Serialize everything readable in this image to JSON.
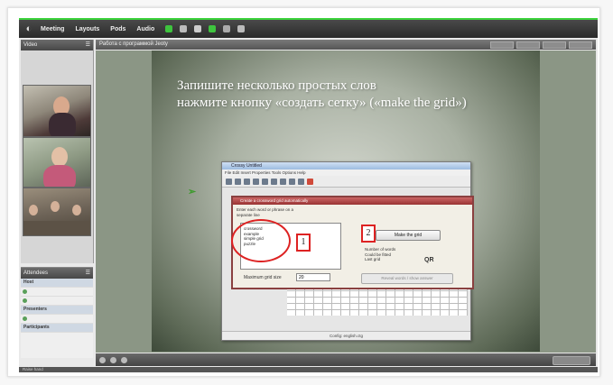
{
  "app": {
    "menu": [
      "Meeting",
      "Layouts",
      "Pods",
      "Audio"
    ],
    "accent_color": "#3dd33d"
  },
  "video_panel": {
    "title": "Video"
  },
  "attendees": {
    "title": "Attendees",
    "rows": [
      {
        "label": "Host"
      },
      {
        "label": "Presenters"
      },
      {
        "label": "Participants"
      }
    ]
  },
  "document": {
    "tab_title": "Работа с программой Jeoty",
    "slide_title_line1": "Запишите несколько простых слов",
    "slide_title_line2": "нажмите кнопку «создать сетку» («make the grid»)"
  },
  "software_window": {
    "title": "Crossy Untitled",
    "menu": "File  Edit  Insert  Properties  Tools  Options  Help",
    "status": "Config: english.ctg"
  },
  "dialog": {
    "title": "Create a crossword grid automatically",
    "instructions": "Enter each word or phrase on a separate line",
    "words": [
      "crossword",
      "example",
      "simple grid",
      "puzzle"
    ],
    "marker1": "1",
    "marker2": "2",
    "make_grid_label": "Make the grid",
    "info_lines": "Number of words\nCould be fitted\nLast grid",
    "qr_label": "QR",
    "max_size_label": "Maximum grid size",
    "max_size_value": "20",
    "reveal_label": "Reveal words / show answer"
  },
  "statusbar": {
    "text": "Raise hand"
  }
}
